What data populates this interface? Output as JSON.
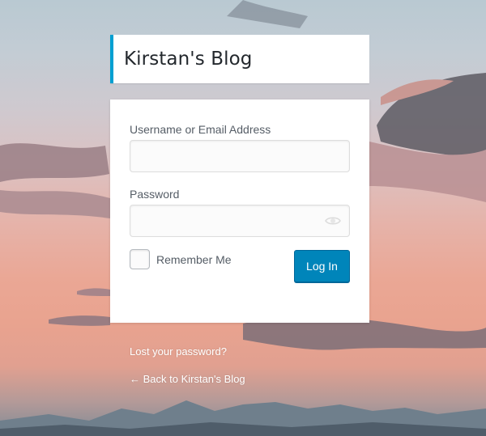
{
  "site": {
    "title": "Kirstan's Blog"
  },
  "form": {
    "username_label": "Username or Email Address",
    "username_value": "",
    "password_label": "Password",
    "password_value": "",
    "remember_label": "Remember Me",
    "remember_checked": false,
    "login_button": "Log In"
  },
  "links": {
    "lost_password": "Lost your password?",
    "back_to_blog": "← Back to Kirstan's Blog"
  },
  "colors": {
    "accent": "#00a0d2",
    "button": "#0085ba"
  },
  "icons": {
    "password_toggle": "eye-icon"
  }
}
